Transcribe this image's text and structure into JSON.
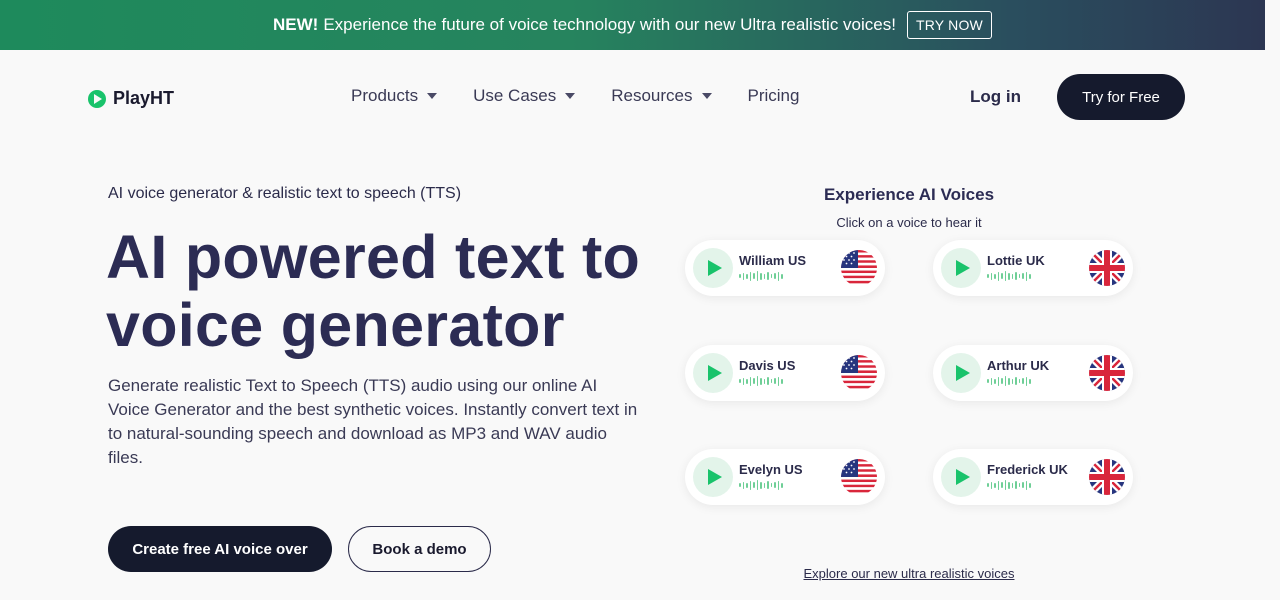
{
  "announcement": {
    "new_label": "NEW!",
    "text": "Experience the future of voice technology with our new Ultra realistic voices!",
    "cta_label": "TRY NOW"
  },
  "nav": {
    "logo_text": "PlayHT",
    "items": [
      {
        "label": "Products",
        "has_dropdown": true
      },
      {
        "label": "Use Cases",
        "has_dropdown": true
      },
      {
        "label": "Resources",
        "has_dropdown": true
      },
      {
        "label": "Pricing",
        "has_dropdown": false
      }
    ],
    "login_label": "Log in",
    "try_free_label": "Try for Free"
  },
  "hero": {
    "eyebrow": "AI voice generator & realistic text to speech (TTS)",
    "headline": "AI powered text to voice generator",
    "description": "Generate realistic Text to Speech (TTS) audio using our online AI Voice Generator and the best synthetic voices. Instantly convert text in to natural-sounding speech and download as MP3 and WAV audio files.",
    "primary_cta": "Create free AI voice over",
    "secondary_cta": "Book a demo"
  },
  "voices": {
    "title": "Experience AI Voices",
    "subtitle": "Click on a voice to hear it",
    "items": [
      {
        "name": "William US",
        "flag": "us-flag-icon"
      },
      {
        "name": "Lottie UK",
        "flag": "uk-flag-icon"
      },
      {
        "name": "Davis US",
        "flag": "us-flag-icon"
      },
      {
        "name": "Arthur UK",
        "flag": "uk-flag-icon"
      },
      {
        "name": "Evelyn US",
        "flag": "us-flag-icon"
      },
      {
        "name": "Frederick UK",
        "flag": "uk-flag-icon"
      }
    ],
    "explore_link": "Explore our new ultra realistic voices"
  },
  "colors": {
    "accent_green": "#19c36b",
    "dark_navy": "#151a2d",
    "headline": "#2c2c54"
  }
}
